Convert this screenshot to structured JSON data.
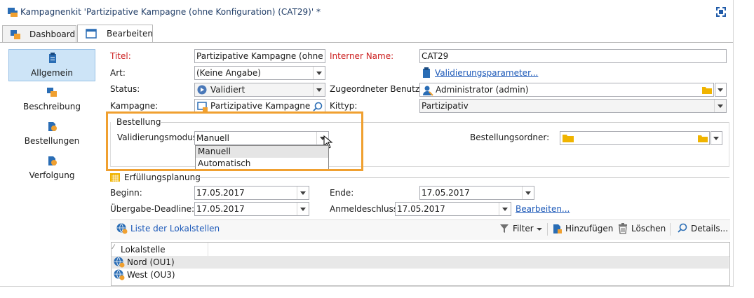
{
  "window": {
    "title": "Kampagnenkit 'Partizipative Kampagne (ohne Konfiguration)  (CAT29)' *",
    "maximize_icon": "expand-icon"
  },
  "tabs": [
    {
      "label": "Dashboard",
      "icon": "dashboard-icon",
      "active": false
    },
    {
      "label": "Bearbeiten",
      "icon": "window-icon",
      "active": true
    }
  ],
  "sidebar": {
    "items": [
      {
        "label": "Allgemein",
        "icon": "clipboard-icon",
        "selected": true
      },
      {
        "label": "Beschreibung",
        "icon": "description-icon",
        "selected": false
      },
      {
        "label": "Bestellungen",
        "icon": "orders-icon",
        "selected": false
      },
      {
        "label": "Verfolgung",
        "icon": "tracking-icon",
        "selected": false
      }
    ]
  },
  "general": {
    "title_label": "Titel:",
    "title_value": "Partizipative Kampagne (ohne Konfiguration)",
    "internal_name_label": "Interner Name:",
    "internal_name_value": "CAT29",
    "type_label": "Art:",
    "type_value": "(Keine Angabe)",
    "validation_link": "Validierungsparameter...",
    "status_label": "Status:",
    "status_value": "Validiert",
    "assigned_user_label": "Zugeordneter Benutzer:",
    "assigned_user_value": "Administrator (admin)",
    "campaign_label": "Kampagne:",
    "campaign_value": "Partizipative Kampagne (ohne Konfiguration)",
    "kit_type_label": "Kittyp:",
    "kit_type_value": "Partizipativ"
  },
  "order": {
    "group_label": "Bestellung",
    "validation_mode_label": "Validierungsmodus:",
    "validation_mode_value": "Manuell",
    "options": [
      "Manuell",
      "Automatisch"
    ],
    "order_folder_label": "Bestellungsordner:",
    "order_folder_value": ""
  },
  "fulfillment": {
    "group_label": "Erfüllungsplanung",
    "start_label": "Beginn:",
    "start_value": "17.05.2017",
    "end_label": "Ende:",
    "end_value": "17.05.2017",
    "handover_label": "Übergabe-Deadline:",
    "handover_value": "17.05.2017",
    "registration_label": "Anmeldeschluss:",
    "registration_value": "17.05.2017",
    "edit_link": "Bearbeiten..."
  },
  "locations": {
    "list_label": "Liste der Lokalstellen",
    "filter_label": "Filter",
    "add_label": "Hinzufügen",
    "delete_label": "Löschen",
    "details_label": "Details...",
    "column_header": "Lokalstelle",
    "rows": [
      "Nord (OU1)",
      "West (OU3)"
    ]
  },
  "colors": {
    "accent": "#1b58b8",
    "highlight_border": "#f0a030",
    "required_label": "#cc1f1f",
    "selected_sidebar": "#cde4f7"
  }
}
